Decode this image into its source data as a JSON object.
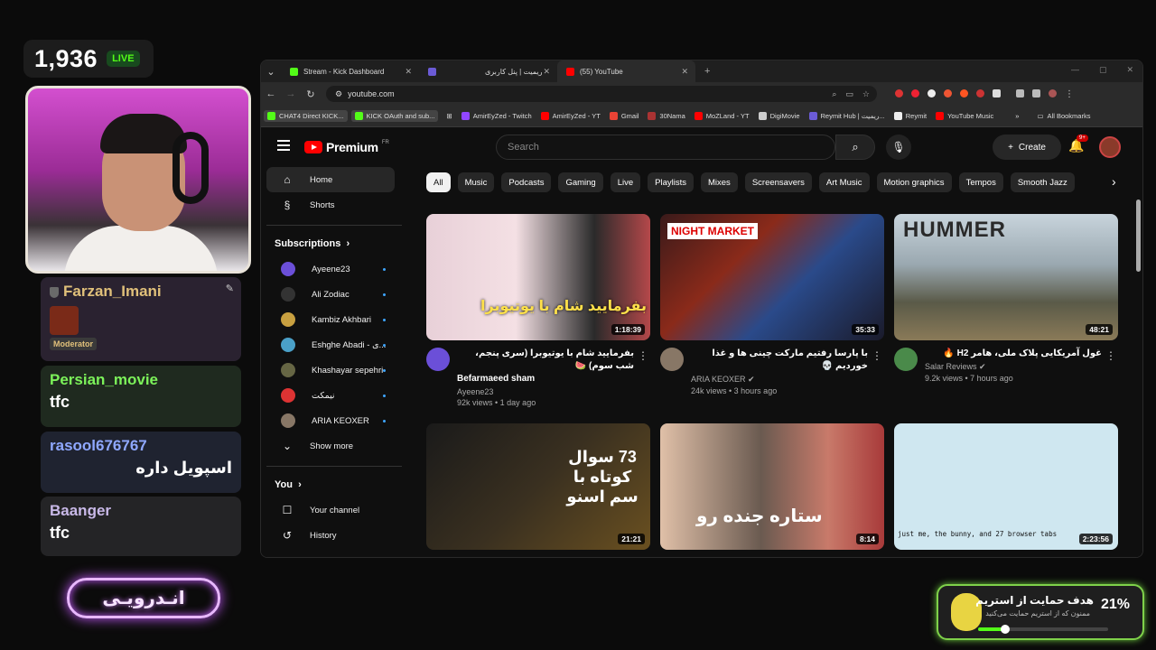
{
  "overlay": {
    "viewer_count": "1,936",
    "live_label": "LIVE",
    "chat": [
      {
        "user": "Farzan_Imani",
        "badge": "Moderator",
        "message": "",
        "color": "#e0c07a"
      },
      {
        "user": "Persian_movie",
        "message": "tfc",
        "color": "#7cf25a"
      },
      {
        "user": "rasool676767",
        "message": "اسپویل داره",
        "color": "#8fa8ff"
      },
      {
        "user": "Baanger",
        "message": "tfc",
        "color": "#c9b9e8"
      }
    ],
    "neon_button": "انـدرویـی",
    "goal": {
      "title": "هدف حمایت از استریم",
      "subtitle": "ممنون که از استریم حمایت می‌کنید",
      "percent_label": "21%",
      "progress": 0.21
    }
  },
  "browser": {
    "tabs": [
      {
        "label": "Stream - Kick Dashboard",
        "icon": "kick-icon",
        "color": "#53fc18"
      },
      {
        "label": "ریمیت | پنل کاربری",
        "icon": "reymit-icon",
        "color": "#6b5bd6"
      },
      {
        "label": "(55) YouTube",
        "icon": "youtube-icon",
        "color": "#ff0000"
      }
    ],
    "url": "youtube.com",
    "bookmarks": [
      {
        "label": "CHAT4 Direct KICK...",
        "boxed": true
      },
      {
        "label": "KICK OAuth and sub...",
        "boxed": true
      },
      {
        "label": "AmirEyZed - Twitch"
      },
      {
        "label": "AmirEyZed - YT"
      },
      {
        "label": "Gmail"
      },
      {
        "label": "30Nama"
      },
      {
        "label": "MoZLand - YT"
      },
      {
        "label": "DigiMovie"
      },
      {
        "label": "Reymit Hub | ریمیت..."
      },
      {
        "label": "Reymit"
      },
      {
        "label": "YouTube Music"
      }
    ],
    "all_bookmarks": "All Bookmarks"
  },
  "youtube": {
    "logo": "Premium",
    "region": "FR",
    "search_placeholder": "Search",
    "create_label": "Create",
    "notif_badge": "9+",
    "sidebar": {
      "home": "Home",
      "shorts": "Shorts",
      "subscriptions_heading": "Subscriptions",
      "subscriptions": [
        "Ayeene23",
        "Ali Zodiac",
        "Kambiz Akhbari",
        "Eshghe Abadi - ی...",
        "Khashayar sepehri",
        "نیمکت",
        "ARIA KEOXER"
      ],
      "show_more": "Show more",
      "you_heading": "You",
      "your_channel": "Your channel",
      "history": "History"
    },
    "chips": [
      "All",
      "Music",
      "Podcasts",
      "Gaming",
      "Live",
      "Playlists",
      "Mixes",
      "Screensavers",
      "Art Music",
      "Motion graphics",
      "Tempos",
      "Smooth Jazz"
    ],
    "videos": [
      {
        "title_rtl": "بفرمایید شام با یوتیوبرا (سری پنجم، شب سوم) 🍉",
        "title": "Befarmaeed sham",
        "channel": "Ayeene23",
        "stats": "92k views • 1 day ago",
        "duration": "1:18:39",
        "thumb_text": "بفرمایید شام با یوتیوبرا"
      },
      {
        "title_rtl": "با پارسا رفتیم مارکت چینی ها و غذا خوردیم 💀",
        "title": "",
        "channel": "ARIA KEOXER",
        "stats": "24k views • 3 hours ago",
        "duration": "35:33",
        "thumb_text": "NIGHT MARKET"
      },
      {
        "title_rtl": "غول آمریکایی پلاک ملی، هامر H2 🔥",
        "title": "",
        "channel": "Salar Reviews",
        "stats": "9.2k views • 7 hours ago",
        "duration": "48:21",
        "thumb_text": "HUMMER"
      },
      {
        "duration": "21:21",
        "thumb_text": "73 سوال کوتاه با سم اسنو"
      },
      {
        "duration": "8:14",
        "thumb_text": "ستاره جنده رو"
      },
      {
        "duration": "2:23:56",
        "thumb_text": "just me, the bunny, and 27 browser tabs"
      }
    ]
  }
}
